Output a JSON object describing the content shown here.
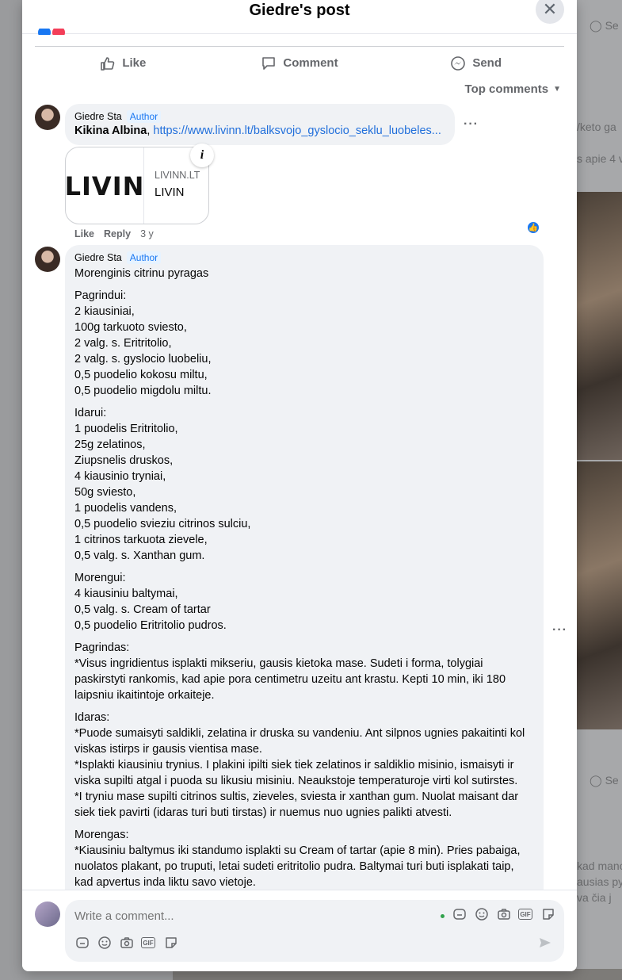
{
  "background": {
    "snippets": [
      "Se",
      "/keto ga",
      "s apie 4 v",
      "Se",
      "kad mano",
      "ausias py",
      "va čia j"
    ]
  },
  "modal": {
    "title": "Giedre's post",
    "close_icon": "✕"
  },
  "actions": {
    "like": "Like",
    "comment": "Comment",
    "send": "Send"
  },
  "sort": {
    "label": "Top comments"
  },
  "comments": [
    {
      "author": "Giedre Sta",
      "badge": "Author",
      "mention": "Kikina Albina",
      "separator": ", ",
      "link": "https://www.livinn.lt/balksvojo_gyslocio_seklu_luobeles...",
      "more": "···",
      "card": {
        "logo_text": "LIVIN",
        "domain": "LIVINN.LT",
        "title": "LIVIN"
      },
      "meta": {
        "like": "Like",
        "reply": "Reply",
        "time": "3 y"
      }
    },
    {
      "author": "Giedre Sta",
      "badge": "Author",
      "more": "···",
      "paragraphs": [
        "Morenginis citrinu pyragas",
        "Pagrindui:\n2 kiausiniai,\n100g tarkuoto sviesto,\n2 valg. s. Eritritolio,\n2 valg. s. gyslocio luobeliu,\n0,5 puodelio kokosu miltu,\n0,5 puodelio migdolu miltu.",
        "Idarui:\n1 puodelis Eritritolio,\n25g zelatinos,\nZiupsnelis druskos,\n4 kiausinio tryniai,\n50g sviesto,\n1 puodelis vandens,\n0,5 puodelio svieziu citrinos sulciu,\n1 citrinos tarkuota zievele,\n0,5 valg. s. Xanthan gum.",
        "Morengui:\n4 kiausiniu baltymai,\n0,5 valg. s. Cream of tartar\n0,5 puodelio Eritritolio pudros.",
        "Pagrindas:\n*Visus ingridientus isplakti mikseriu, gausis kietoka mase. Sudeti i forma, tolygiai paskirstyti rankomis, kad apie pora centimetru uzeitu ant krastu. Kepti 10 min, iki 180 laipsniu ikaitintoje orkaiteje.",
        "Idaras:\n*Puode sumaisyti saldikli, zelatina ir druska su vandeniu. Ant silpnos ugnies pakaitinti kol viskas istirps ir gausis vientisa mase.\n*Isplakti kiausiniu trynius. I plakini ipilti siek tiek zelatinos ir saldiklio misinio, ismaisyti ir viska supilti atgal i puoda su likusiu misiniu. Neaukstoje temperaturoje virti kol sutirstes.\n*I tryniu mase supilti citrinos sultis, zieveles, sviesta ir xanthan gum. Nuolat maisant dar siek tiek pavirti (idaras turi buti tirstas) ir nuemus nuo ugnies palikti atvesti.",
        "Morengas:\n*Kiausiniu baltymus iki standumo isplakti su Cream of tartar (apie 8 min). Pries pabaiga, nuolatos plakant, po truputi, letai sudeti eritritolio pudra. Baltymai turi buti isplakati taip, kad apvertus inda liktu savo vietoje."
      ]
    }
  ],
  "composer": {
    "placeholder": "Write a comment...",
    "gif_label": "GIF"
  },
  "colors": {
    "accent": "#1877f2",
    "link": "#216fdb",
    "bubble": "#f0f2f5",
    "muted": "#65676b"
  }
}
